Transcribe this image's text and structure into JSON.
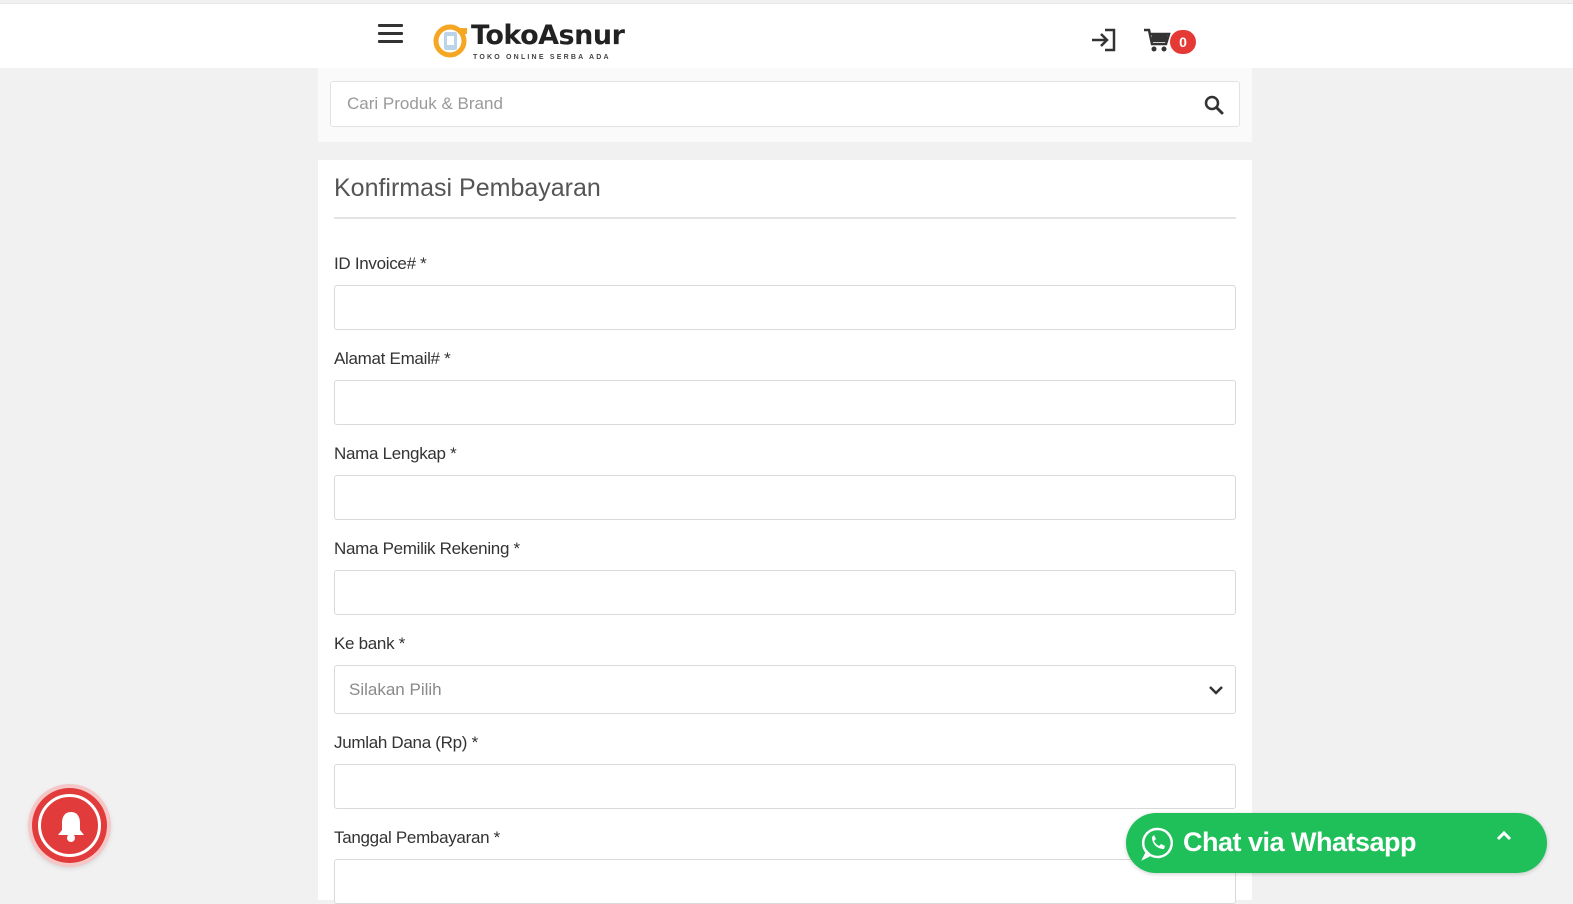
{
  "header": {
    "menu_icon": "hamburger-icon",
    "logo": {
      "name": "TokoAsnur",
      "tagline": "TOKO ONLINE SERBA ADA"
    },
    "login_icon": "login-icon",
    "cart_icon": "cart-icon",
    "cart_count": "0",
    "colors": {
      "badge": "#e53935"
    }
  },
  "search": {
    "placeholder": "Cari Produk & Brand",
    "icon": "search-icon"
  },
  "form": {
    "title": "Konfirmasi Pembayaran",
    "fields": [
      {
        "label": "ID Invoice# *",
        "type": "text",
        "value": ""
      },
      {
        "label": "Alamat Email# *",
        "type": "text",
        "value": ""
      },
      {
        "label": "Nama Lengkap *",
        "type": "text",
        "value": ""
      },
      {
        "label": "Nama Pemilik Rekening *",
        "type": "text",
        "value": ""
      },
      {
        "label": "Ke bank *",
        "type": "select",
        "value": "Silakan Pilih"
      },
      {
        "label": "Jumlah Dana (Rp) *",
        "type": "text",
        "value": ""
      },
      {
        "label": "Tanggal Pembayaran *",
        "type": "text",
        "value": ""
      }
    ]
  },
  "floating": {
    "notification_icon": "bell-icon",
    "whatsapp": {
      "label": "Chat via Whatsapp",
      "icon": "whatsapp-icon",
      "color": "#1fbf5a"
    },
    "notification_color": "#e23b3b"
  }
}
